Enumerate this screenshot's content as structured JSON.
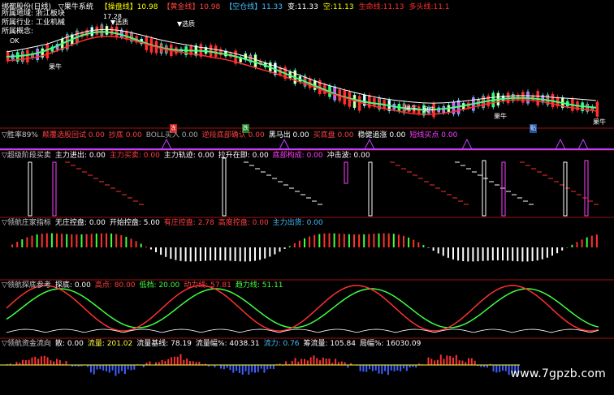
{
  "app": {
    "title": "绑都股份(日线)",
    "subtitle": "▽果牛系统",
    "chips": [
      {
        "label": "【操盘线】",
        "value": "10.98",
        "color": "#ffff00"
      },
      {
        "label": "【黄金线】",
        "value": "10.98",
        "color": "#ff4040"
      },
      {
        "label": "【空仓线】",
        "value": "11.33",
        "color": "#40c0ff"
      },
      {
        "label": "变:",
        "value": "11.33",
        "color": "#ffffff"
      },
      {
        "label": "空:",
        "value": "11.13",
        "color": "#ffff00"
      },
      {
        "label": "生命线:",
        "value": "11.13",
        "color": "#ff3030"
      },
      {
        "label": "多头线:",
        "value": "11.1",
        "color": "#ff3030"
      }
    ]
  },
  "info": {
    "line1": "所属地域: 浙江板块",
    "line2": "所属行业: 工业机械",
    "line3": "所属概念:",
    "ok": "OK"
  },
  "price_labels": {
    "high": "17.28",
    "pick1": "▼选质",
    "pick2": "▼选质",
    "guo_niu_tags": [
      "果牛",
      "果牛",
      "果牛",
      "果牛",
      "果牛"
    ]
  },
  "separator_tags": [
    "冻",
    "跌",
    "贴"
  ],
  "panels": [
    {
      "name": "胜率89%",
      "items": [
        {
          "t": "▽胜率89%",
          "c": "#cccccc"
        },
        {
          "t": "颠覆选股回试 0.00",
          "c": "#ff4040"
        },
        {
          "t": "抄底 0.00",
          "c": "#ff4040"
        },
        {
          "t": "BOLL买入 0.00",
          "c": "#aaaaaa"
        },
        {
          "t": "逆段底部确认 0.00",
          "c": "#ff4040"
        },
        {
          "t": "黑马出 0.00",
          "c": "#ffffff"
        },
        {
          "t": "买底盘 0.00",
          "c": "#ff4040"
        },
        {
          "t": "稳健追涨 0.00",
          "c": "#ffffff"
        },
        {
          "t": "短线买点 0.00",
          "c": "#ff40ff"
        }
      ]
    },
    {
      "name": "超级阶段买卖",
      "items": [
        {
          "t": "▽超级阶段买卖",
          "c": "#cccccc"
        },
        {
          "t": "主力进出: 0.00",
          "c": "#ffffff"
        },
        {
          "t": "主力买卖: 0.00",
          "c": "#ff4040"
        },
        {
          "t": "主力轨迹: 0.00",
          "c": "#ffffff"
        },
        {
          "t": "拉升在即: 0.00",
          "c": "#ffffff"
        },
        {
          "t": "底部构成: 0.00",
          "c": "#ff40ff"
        },
        {
          "t": "冲击波: 0.00",
          "c": "#ffffff"
        }
      ]
    },
    {
      "name": "领航庄家指标",
      "items": [
        {
          "t": "▽领航庄家指标",
          "c": "#cccccc"
        },
        {
          "t": "无庄控盘: 0.00",
          "c": "#ffffff"
        },
        {
          "t": "开始控盘: 5.00",
          "c": "#ffffff"
        },
        {
          "t": "有庄控盘: 2.78",
          "c": "#ff4040"
        },
        {
          "t": "高度控盘: 0.00",
          "c": "#ff4040"
        },
        {
          "t": "主力出货: 0.00",
          "c": "#40c0ff"
        }
      ]
    },
    {
      "name": "领航探底参考",
      "items": [
        {
          "t": "▽领航探底参考",
          "c": "#cccccc"
        },
        {
          "t": "探底: 0.00",
          "c": "#ffffff"
        },
        {
          "t": "高点: 80.00",
          "c": "#ff4040"
        },
        {
          "t": "低档: 20.00",
          "c": "#40ff40"
        },
        {
          "t": "动力线: 57.81",
          "c": "#ff4040"
        },
        {
          "t": "趋力线: 51.11",
          "c": "#40ff40"
        }
      ]
    },
    {
      "name": "领航资金流向",
      "items": [
        {
          "t": "▽领航资金流向",
          "c": "#cccccc"
        },
        {
          "t": "散: 0.00",
          "c": "#ffffff"
        },
        {
          "t": "流量: 201.02",
          "c": "#ffff40"
        },
        {
          "t": "流量基线: 78.19",
          "c": "#ffffff"
        },
        {
          "t": "流量幅%: 4038.31",
          "c": "#ffffff"
        },
        {
          "t": "流力: 0.76",
          "c": "#40c0ff"
        },
        {
          "t": "筹流量: 105.84",
          "c": "#ffffff"
        },
        {
          "t": "局幅%: 16030.09",
          "c": "#ffffff"
        }
      ]
    }
  ],
  "watermark": "www.7gpzb.com"
}
